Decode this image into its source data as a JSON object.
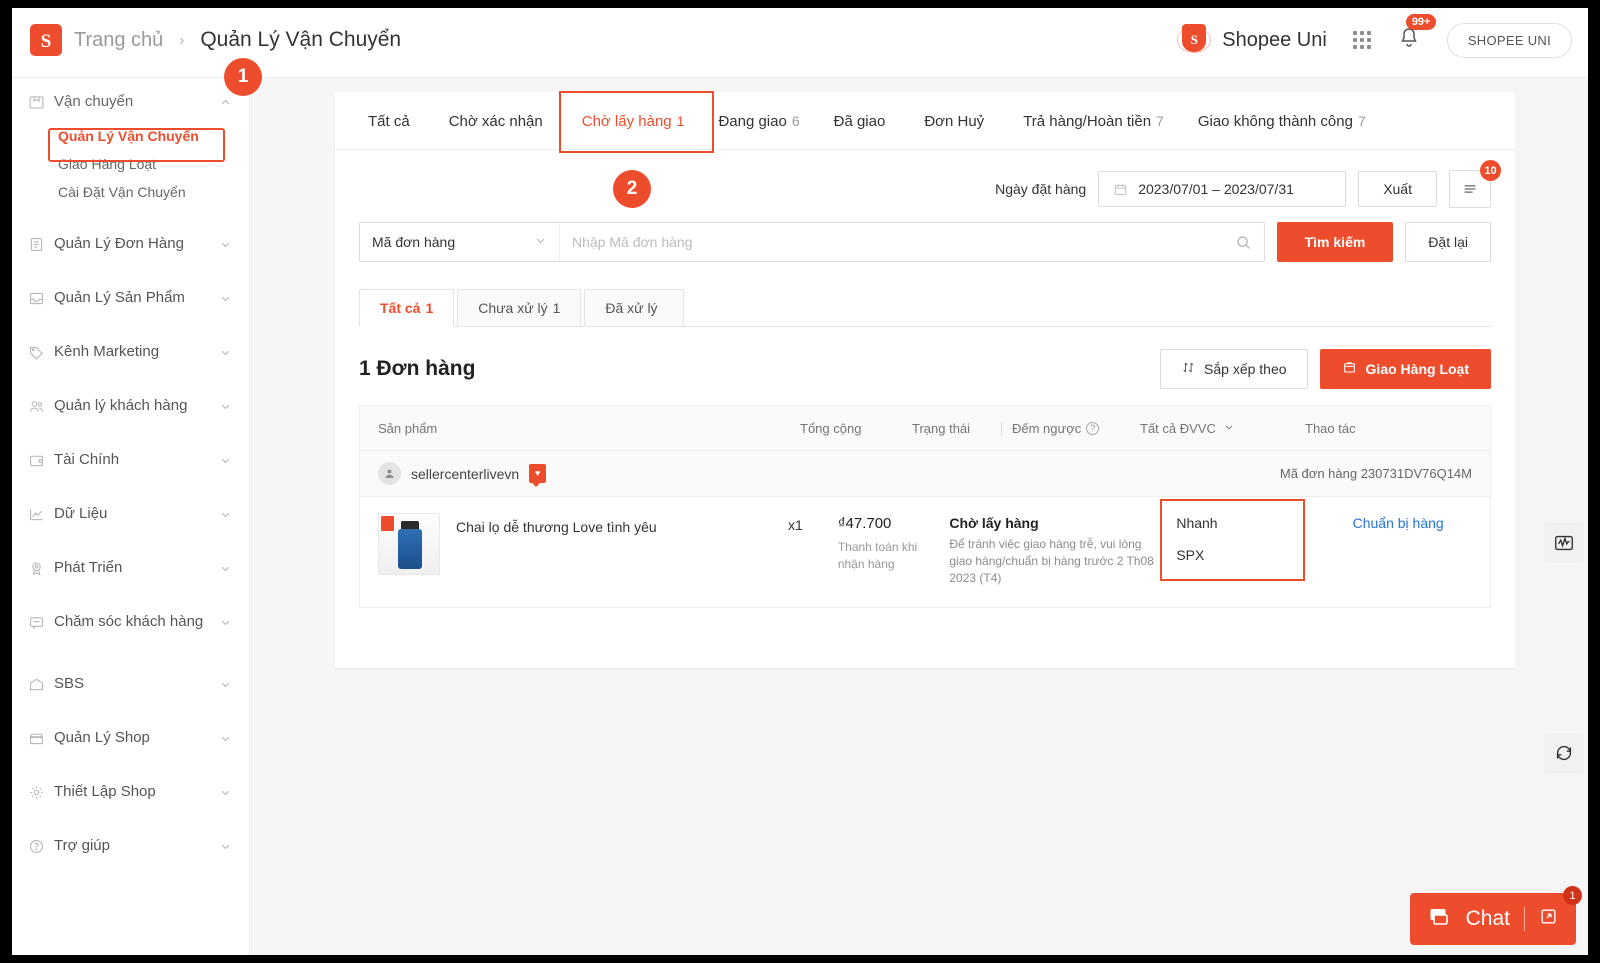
{
  "header": {
    "logo_icon": "shopee-bag-icon",
    "breadcrumb_home": "Trang chủ",
    "breadcrumb_sep": "›",
    "breadcrumb_current": "Quản Lý Vận Chuyển",
    "uni_icon": "shopee-uni-shield-icon",
    "uni_name": "Shopee Uni",
    "apps_icon": "grid-apps-icon",
    "bell_icon": "bell-icon",
    "bell_badge": "99+",
    "account_label": "SHOPEE UNI"
  },
  "sidebar": {
    "groups": [
      {
        "label": "Vận chuyển",
        "icon": "truck-icon",
        "expanded": true,
        "chevron": "chevron-up-icon",
        "subitems": [
          {
            "label": "Quản Lý Vận Chuyển",
            "active": true
          },
          {
            "label": "Giao Hàng Loạt",
            "active": false
          },
          {
            "label": "Cài Đặt Vận Chuyển",
            "active": false
          }
        ]
      },
      {
        "label": "Quản Lý Đơn Hàng",
        "icon": "clipboard-icon",
        "expanded": false,
        "chevron": "chevron-down-icon",
        "subitems": []
      },
      {
        "label": "Quản Lý Sản Phẩm",
        "icon": "inbox-icon",
        "expanded": false,
        "chevron": "chevron-down-icon",
        "subitems": []
      },
      {
        "label": "Kênh Marketing",
        "icon": "tag-icon",
        "expanded": false,
        "chevron": "chevron-down-icon",
        "subitems": []
      },
      {
        "label": "Quản lý khách hàng",
        "icon": "users-icon",
        "expanded": false,
        "chevron": "chevron-down-icon",
        "subitems": []
      },
      {
        "label": "Tài Chính",
        "icon": "wallet-icon",
        "expanded": false,
        "chevron": "chevron-down-icon",
        "subitems": []
      },
      {
        "label": "Dữ Liệu",
        "icon": "chart-line-icon",
        "expanded": false,
        "chevron": "chevron-down-icon",
        "subitems": []
      },
      {
        "label": "Phát Triển",
        "icon": "badge-icon",
        "expanded": false,
        "chevron": "chevron-down-icon",
        "subitems": []
      },
      {
        "label": "Chăm sóc khách hàng",
        "icon": "chat-bubble-icon",
        "expanded": false,
        "chevron": "chevron-down-icon",
        "subitems": []
      },
      {
        "label": "SBS",
        "icon": "warehouse-icon",
        "expanded": false,
        "chevron": "chevron-down-icon",
        "subitems": []
      },
      {
        "label": "Quản Lý Shop",
        "icon": "storefront-icon",
        "expanded": false,
        "chevron": "chevron-down-icon",
        "subitems": []
      },
      {
        "label": "Thiết Lập Shop",
        "icon": "gear-icon",
        "expanded": false,
        "chevron": "chevron-down-icon",
        "subitems": []
      },
      {
        "label": "Trợ giúp",
        "icon": "question-circle-icon",
        "expanded": false,
        "chevron": "chevron-down-icon",
        "subitems": []
      }
    ]
  },
  "annotations": {
    "step1": "1",
    "step2": "2",
    "highlight_color": "#ee4d2d"
  },
  "tabs": [
    {
      "label": "Tất cả",
      "count": "",
      "active": false
    },
    {
      "label": "Chờ xác nhận",
      "count": "",
      "active": false
    },
    {
      "label": "Chờ lấy hàng",
      "count": "1",
      "active": true
    },
    {
      "label": "Đang giao",
      "count": "6",
      "active": false
    },
    {
      "label": "Đã giao",
      "count": "",
      "active": false
    },
    {
      "label": "Đơn Huỷ",
      "count": "",
      "active": false
    },
    {
      "label": "Trả hàng/Hoàn tiền",
      "count": "7",
      "active": false
    },
    {
      "label": "Giao không thành công",
      "count": "7",
      "active": false
    }
  ],
  "filter": {
    "date_label": "Ngày đặt hàng",
    "calendar_icon": "calendar-icon",
    "date_value": "2023/07/01 – 2023/07/31",
    "export_label": "Xuất",
    "list_icon": "list-lines-icon",
    "list_badge": "10"
  },
  "search": {
    "select_value": "Mã đơn hàng",
    "select_chevron": "chevron-down-icon",
    "placeholder": "Nhập Mã đơn hàng",
    "input_value": "",
    "search_icon": "search-icon",
    "search_label": "Tìm kiếm",
    "reset_label": "Đặt lại"
  },
  "subtabs": [
    {
      "label": "Tất cả",
      "count": "1",
      "active": true
    },
    {
      "label": "Chưa xử lý",
      "count": "1",
      "active": false
    },
    {
      "label": "Đã xử lý",
      "count": "",
      "active": false
    }
  ],
  "list": {
    "order_count": "1 Đơn hàng",
    "sort_icon": "sort-icon",
    "sort_label": "Sắp xếp theo",
    "bulk_icon": "box-icon",
    "bulk_label": "Giao Hàng Loạt"
  },
  "table": {
    "headers": {
      "product": "Sản phẩm",
      "total": "Tổng cộng",
      "status": "Trạng thái",
      "countdown": "Đếm ngược",
      "countdown_help_icon": "question-circle-icon",
      "carrier": "Tất cả ĐVVC",
      "carrier_chevron": "chevron-down-icon",
      "action": "Thao tác"
    },
    "order": {
      "avatar_icon": "user-avatar-icon",
      "shop_name": "sellercenterlivevn",
      "chat_icon": "chat-flag-icon",
      "order_id_label": "Mã đơn hàng 230731DV76Q14M",
      "product_image": "product-thumbnail-bottle",
      "product_name": "Chai lọ dễ thương Love tình yêu",
      "quantity": "x1",
      "total_amount": "₫47.700",
      "payment_note": "Thanh toán khi nhận hàng",
      "status_title": "Chờ lấy hàng",
      "status_desc": "Để tránh việc giao hàng trễ, vui lòng giao hàng/chuẩn bị hàng trước 2 Th08 2023 (T4)",
      "carrier_speed": "Nhanh",
      "carrier_name": "SPX",
      "action_label": "Chuẩn bị hàng"
    }
  },
  "rail": {
    "analytics_icon": "analytics-monitor-icon",
    "refresh_icon": "refresh-circle-icon"
  },
  "chat": {
    "chat_icon": "chat-window-icon",
    "label": "Chat",
    "expand_icon": "expand-icon",
    "unread": "1"
  }
}
